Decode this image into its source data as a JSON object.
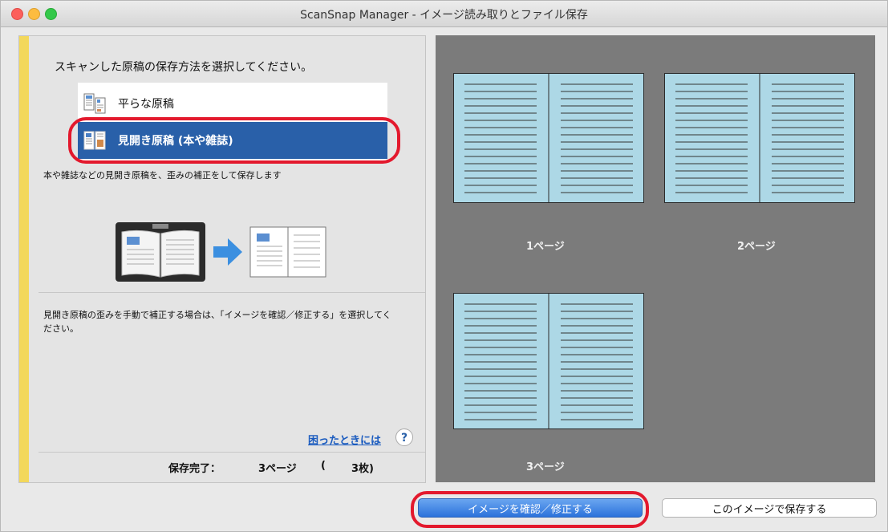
{
  "window": {
    "title": "ScanSnap Manager - イメージ読み取りとファイル保存"
  },
  "left": {
    "instruction": "スキャンした原稿の保存方法を選択してください。",
    "options": [
      {
        "label": "平らな原稿",
        "icon": "flat-document-icon",
        "selected": false
      },
      {
        "label": "見開き原稿 (本や雑誌)",
        "icon": "book-spread-icon",
        "selected": true
      }
    ],
    "description": "本や雑誌などの見開き原稿を、歪みの補正をして保存します",
    "note": "見開き原稿の歪みを手動で補正する場合は、「イメージを確認／修正する」を選択してください。",
    "help_link": "困ったときには",
    "help_icon": "?",
    "status": {
      "label": "保存完了：",
      "pages": "3ページ",
      "paren_open": "(",
      "sheets": "3枚)"
    }
  },
  "preview": {
    "pages": [
      {
        "label": "1ページ"
      },
      {
        "label": "2ページ"
      },
      {
        "label": "3ページ"
      }
    ]
  },
  "buttons": {
    "check_fix": "イメージを確認／修正する",
    "save_this": "このイメージで保存する"
  },
  "colors": {
    "selection": "#2960a9",
    "highlight_ring": "#e3192d",
    "page_fill": "#add8e6",
    "accent_yellow": "#f3d85b"
  }
}
